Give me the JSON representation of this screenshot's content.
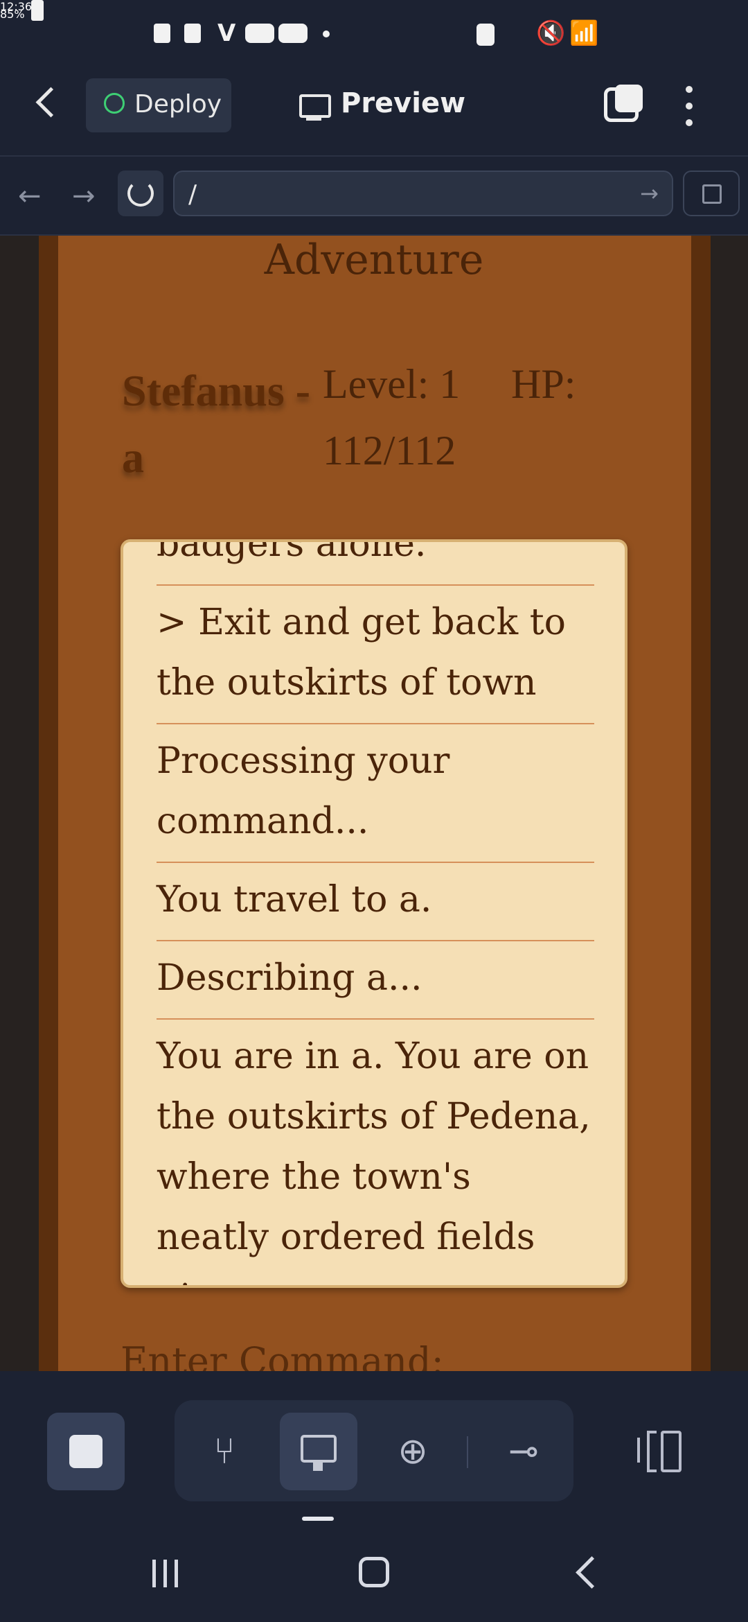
{
  "status_bar": {
    "time": "12:36",
    "battery": "85%"
  },
  "header": {
    "deploy_label": "Deploy",
    "preview_label": "Preview"
  },
  "url_bar": {
    "path": "/"
  },
  "game": {
    "title": "Adventure",
    "player_name": "Stefanus - a",
    "level_text": "Level: 1",
    "hp_label": "HP:",
    "hp_value": "112/112",
    "log": [
      "badgers alone.",
      "> Exit and get back to the outskirts of town",
      "Processing your command...",
      "You travel to a.",
      "Describing a...",
      "You are in a. You are on the outskirts of Pedena, where the town's neatly ordered fields give way"
    ],
    "command_prompt": "Enter Command:"
  },
  "colors": {
    "app_bg": "#1c2232",
    "frame_dark": "#5b2f0e",
    "frame": "#93511f",
    "parchment": "#f5dfb5",
    "text_brown": "#4a2409",
    "divider": "#d6905a"
  },
  "icons": {
    "deploy": "deploy-antenna-icon",
    "preview": "monitor-icon",
    "tabs": "tabs-icon",
    "menu": "more-vertical-icon",
    "stop": "stop-icon",
    "git": "branch-icon",
    "preview_tool": "monitor-icon",
    "deploy_tool": "deploy-antenna-icon",
    "flow": "workflow-icon",
    "sidebar": "sidebar-toggle-icon"
  }
}
